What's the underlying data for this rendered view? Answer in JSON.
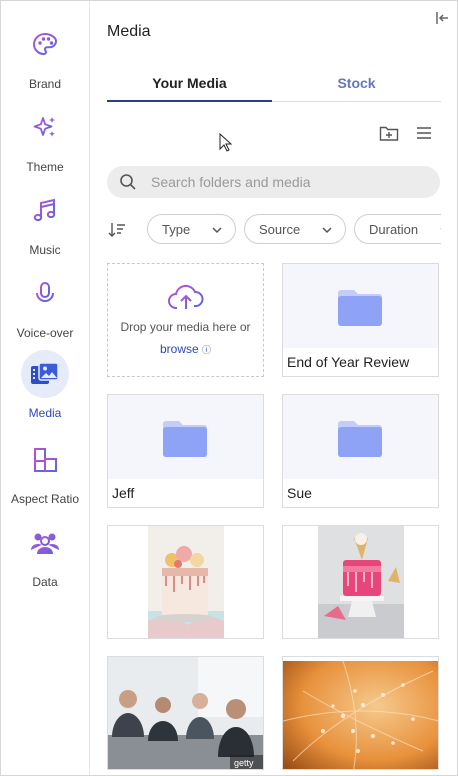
{
  "sidebar": {
    "items": [
      {
        "label": "Brand",
        "icon": "palette-icon",
        "active": false
      },
      {
        "label": "Theme",
        "icon": "sparkles-icon",
        "active": false
      },
      {
        "label": "Music",
        "icon": "music-note-icon",
        "active": false
      },
      {
        "label": "Voice-over",
        "icon": "microphone-icon",
        "active": false
      },
      {
        "label": "Media",
        "icon": "media-icon",
        "active": true
      },
      {
        "label": "Aspect Ratio",
        "icon": "aspect-ratio-icon",
        "active": false
      },
      {
        "label": "Data",
        "icon": "users-icon",
        "active": false
      }
    ]
  },
  "panel": {
    "title": "Media",
    "tabs": [
      {
        "label": "Your Media",
        "active": true
      },
      {
        "label": "Stock",
        "active": false
      }
    ],
    "search": {
      "placeholder": "Search folders and media",
      "value": ""
    },
    "filters": [
      {
        "label": "Type"
      },
      {
        "label": "Source"
      },
      {
        "label": "Duration"
      }
    ],
    "upload": {
      "text": "Drop your media here or",
      "link": "browse"
    },
    "folders": [
      {
        "name": "End of Year Review"
      },
      {
        "name": "Jeff"
      },
      {
        "name": "Sue"
      }
    ],
    "media_items": [
      {
        "description": "cake-photo"
      },
      {
        "description": "cake-photo-2"
      },
      {
        "description": "meeting-photo",
        "watermark": "getty"
      },
      {
        "description": "dew-web-photo"
      }
    ]
  },
  "colors": {
    "accent": "#2d47b8",
    "icon_gradient_start": "#b04fd6",
    "icon_gradient_end": "#4f6ae0",
    "folder": "#8ea3f5",
    "active_nav_bg": "#e6ebf9"
  }
}
